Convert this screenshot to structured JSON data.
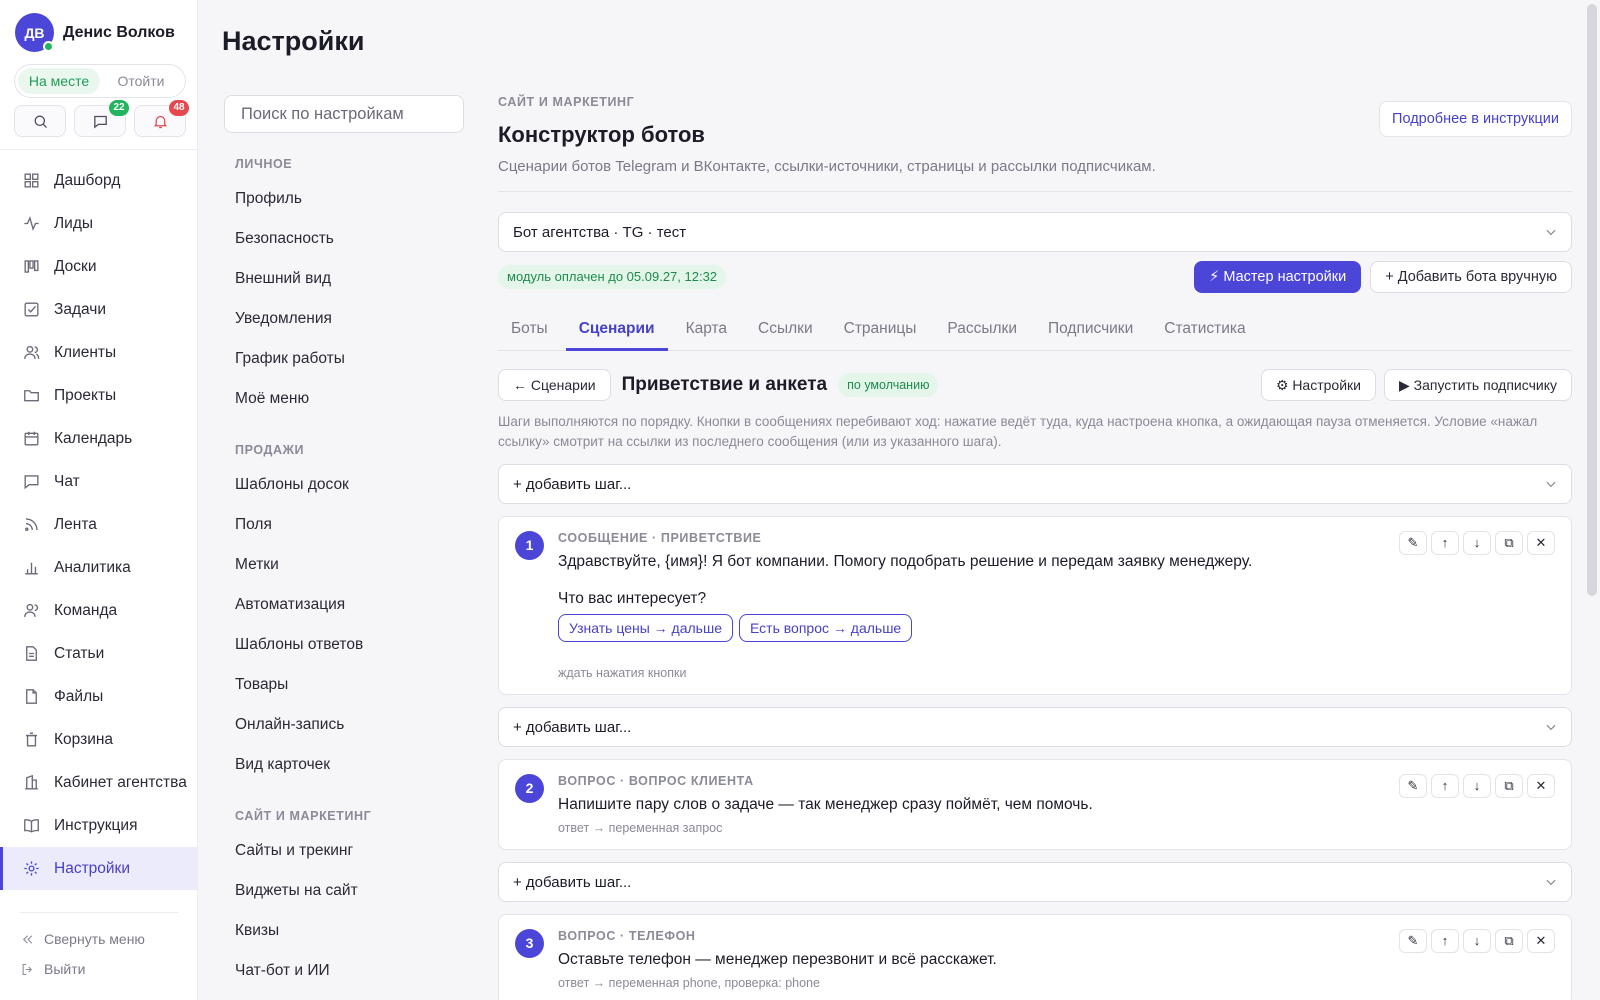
{
  "user": {
    "initials": "ДВ",
    "name": "Денис Волков",
    "status_on": "На месте",
    "status_off": "Отойти"
  },
  "quick": {
    "messages_badge": "22",
    "notifications_badge": "48"
  },
  "nav": [
    {
      "label": "Дашборд",
      "icon": "dashboard-icon"
    },
    {
      "label": "Лиды",
      "icon": "pulse-icon"
    },
    {
      "label": "Доски",
      "icon": "board-icon"
    },
    {
      "label": "Задачи",
      "icon": "task-icon"
    },
    {
      "label": "Клиенты",
      "icon": "users-icon"
    },
    {
      "label": "Проекты",
      "icon": "folder-icon"
    },
    {
      "label": "Календарь",
      "icon": "calendar-icon"
    },
    {
      "label": "Чат",
      "icon": "chat-icon"
    },
    {
      "label": "Лента",
      "icon": "feed-icon"
    },
    {
      "label": "Аналитика",
      "icon": "chart-icon"
    },
    {
      "label": "Команда",
      "icon": "team-icon"
    },
    {
      "label": "Статьи",
      "icon": "article-icon"
    },
    {
      "label": "Файлы",
      "icon": "file-icon"
    },
    {
      "label": "Корзина",
      "icon": "trash-icon"
    },
    {
      "label": "Кабинет агентства",
      "icon": "building-icon"
    },
    {
      "label": "Инструкция",
      "icon": "book-icon"
    },
    {
      "label": "Настройки",
      "icon": "gear-icon"
    }
  ],
  "side_bottom": {
    "collapse": "Свернуть меню",
    "logout": "Выйти"
  },
  "page_title": "Настройки",
  "settings_nav": {
    "search_placeholder": "Поиск по настройкам",
    "sections": [
      {
        "title": "ЛИЧНОЕ",
        "items": [
          "Профиль",
          "Безопасность",
          "Внешний вид",
          "Уведомления",
          "График работы",
          "Моё меню"
        ]
      },
      {
        "title": "ПРОДАЖИ",
        "items": [
          "Шаблоны досок",
          "Поля",
          "Метки",
          "Автоматизация",
          "Шаблоны ответов",
          "Товары",
          "Онлайн-запись",
          "Вид карточек"
        ]
      },
      {
        "title": "САЙТ И МАРКЕТИНГ",
        "items": [
          "Сайты и трекинг",
          "Виджеты на сайт",
          "Квизы",
          "Чат-бот и ИИ"
        ]
      }
    ]
  },
  "main": {
    "eyebrow": "САЙТ И МАРКЕТИНГ",
    "title": "Конструктор ботов",
    "description": "Сценарии ботов Telegram и ВКонтакте, ссылки-источники, страницы и рассылки подписчикам.",
    "help_button": "Подробнее в инструкции",
    "bot_select": "Бот агентства · TG · тест",
    "paid_badge": "модуль оплачен до 05.09.27, 12:32",
    "wizard_button": "⚡ Мастер настройки",
    "add_bot_button": "+ Добавить бота вручную",
    "tabs": [
      "Боты",
      "Сценарии",
      "Карта",
      "Ссылки",
      "Страницы",
      "Рассылки",
      "Подписчики",
      "Статистика"
    ],
    "active_tab": 1,
    "back_button": "← Сценарии",
    "scenario_title": "Приветствие и анкета",
    "default_badge": "по умолчанию",
    "settings_button": "⚙ Настройки",
    "run_button": "▶ Запустить подписчику",
    "hint": "Шаги выполняются по порядку. Кнопки в сообщениях перебивают ход: нажатие ведёт туда, куда настроена кнопка, а ожидающая пауза отменяется. Условие «нажал ссылку» смотрит на ссылки из последнего сообщения (или из указанного шага).",
    "add_step": "+ добавить шаг...",
    "steps": [
      {
        "num": "1",
        "type": "СООБЩЕНИЕ · ПРИВЕТСТВИЕ",
        "text": "Здравствуйте, {имя}! Я бот компании. Помогу подобрать решение и передам заявку менеджеру.",
        "question": "Что вас интересует?",
        "buttons": [
          "Узнать цены → дальше",
          "Есть вопрос → дальше"
        ],
        "meta": "ждать нажатия кнопки"
      },
      {
        "num": "2",
        "type": "ВОПРОС · ВОПРОС КЛИЕНТА",
        "text": "Напишите пару слов о задаче — так менеджер сразу поймёт, чем помочь.",
        "meta": "ответ → переменная запрос"
      },
      {
        "num": "3",
        "type": "ВОПРОС · ТЕЛЕФОН",
        "text": "Оставьте телефон — менеджер перезвонит и всё расскажет.",
        "meta": "ответ → переменная phone, проверка: phone"
      }
    ],
    "step_tools": [
      "✎",
      "↑",
      "↓",
      "⧉",
      "✕"
    ]
  },
  "colors": {
    "accent": "#4b45d8",
    "success": "#22b55e",
    "danger": "#e5484d"
  }
}
